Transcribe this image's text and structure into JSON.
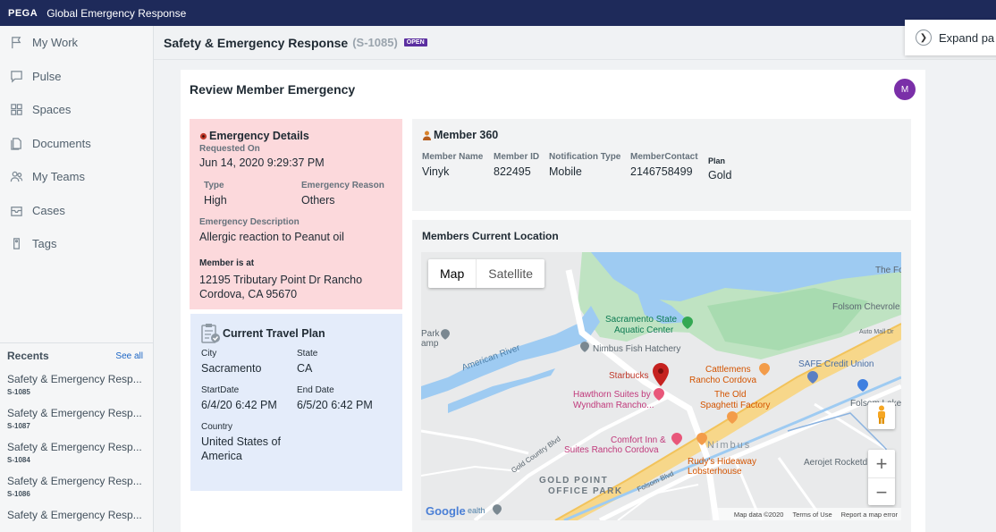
{
  "topbar": {
    "brand": "PEGA",
    "app_title": "Global Emergency Response"
  },
  "sidebar": {
    "items": [
      {
        "label": "My Work",
        "icon": "flag-icon"
      },
      {
        "label": "Pulse",
        "icon": "chat-icon"
      },
      {
        "label": "Spaces",
        "icon": "grid-icon"
      },
      {
        "label": "Documents",
        "icon": "document-icon"
      },
      {
        "label": "My Teams",
        "icon": "team-icon"
      },
      {
        "label": "Cases",
        "icon": "inbox-icon"
      },
      {
        "label": "Tags",
        "icon": "tag-icon"
      }
    ],
    "recents_title": "Recents",
    "see_all": "See all",
    "recents": [
      {
        "name": "Safety & Emergency Resp...",
        "id": "S-1085"
      },
      {
        "name": "Safety & Emergency Resp...",
        "id": "S-1087"
      },
      {
        "name": "Safety & Emergency Resp...",
        "id": "S-1084"
      },
      {
        "name": "Safety & Emergency Resp...",
        "id": "S-1086"
      },
      {
        "name": "Safety & Emergency Resp...",
        "id": ""
      }
    ]
  },
  "case": {
    "title": "Safety & Emergency Response",
    "id": "(S-1085)",
    "status": "OPEN",
    "expand_label": "Expand pa"
  },
  "review": {
    "title": "Review Member Emergency",
    "avatar": "M",
    "emergency": {
      "heading": "Emergency Details",
      "requested_on_label": "Requested On",
      "requested_on": "Jun 14, 2020 9:29:37 PM",
      "type_label": "Type",
      "type": "High",
      "reason_label": "Emergency Reason",
      "reason": "Others",
      "description_label": "Emergency Description",
      "description": "Allergic reaction to Peanut oil",
      "location_label": "Member is at",
      "location_line1": "12195 Tributary Point Dr Rancho",
      "location_line2": "Cordova, CA 95670"
    },
    "travel": {
      "heading": "Current Travel Plan",
      "city_label": "City",
      "city": "Sacramento",
      "state_label": "State",
      "state": "CA",
      "start_label": "StartDate",
      "start": "6/4/20 6:42 PM",
      "end_label": "End Date",
      "end": "6/5/20 6:42 PM",
      "country_label": "Country",
      "country_line1": "United States of",
      "country_line2": "America"
    },
    "member360": {
      "heading": "Member 360",
      "name_label": "Member Name",
      "name": "Vinyk",
      "id_label": "Member ID",
      "id": "822495",
      "notif_label": "Notification Type",
      "notif": "Mobile",
      "contact_label": "MemberContact",
      "contact": "2146758499",
      "plan_label": "Plan",
      "plan": "Gold"
    },
    "location": {
      "heading": "Members Current Location",
      "map_btn": "Map",
      "satellite_btn": "Satellite",
      "zoom_in": "+",
      "zoom_out": "−",
      "labels": {
        "aquatic1": "Sacramento State",
        "aquatic2": "Aquatic Center",
        "hatchery": "Nimbus Fish Hatchery",
        "river": "American River",
        "starbucks": "Starbucks",
        "hawthorn1": "Hawthorn Suites by",
        "hawthorn2": "Wyndham Rancho...",
        "cattlemens1": "Cattlemens",
        "cattlemens2": "Rancho Cordova",
        "oldspaghetti1": "The Old",
        "oldspaghetti2": "Spaghetti Factory",
        "safe": "SAFE Credit Union",
        "folsom_chev": "Folsom Chevrole",
        "comfort1": "Comfort Inn &",
        "comfort2": "Suites Rancho Cordova",
        "nimbus": "Nimbus",
        "rudys1": "Rudy's Hideaway",
        "rudys2": "Lobsterhouse",
        "aerojet": "Aerojet Rocketd",
        "goldpoint1": "GOLD POINT",
        "goldpoint2": "OFFICE PARK",
        "folsom_lake": "Folsom Lake",
        "auto_mall": "Auto Mall Dr",
        "park": "Park",
        "amp": "amp",
        "the_fo": "The Fo",
        "gold_country": "Gold Country Blvd",
        "folsom_blvd": "Folsom Blvd",
        "ealth": "ealth"
      },
      "google": "Google",
      "map_data": "Map data ©2020",
      "terms": "Terms of Use",
      "report": "Report a map error"
    }
  }
}
